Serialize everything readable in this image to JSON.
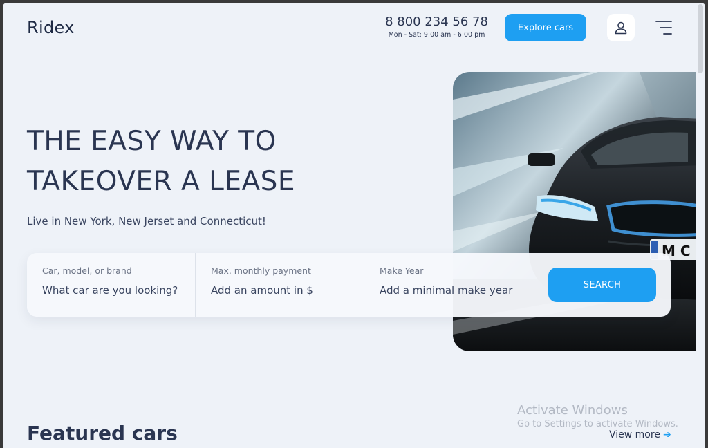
{
  "header": {
    "logo": "Ridex",
    "phone": "8 800 234 56 78",
    "hours": "Mon - Sat: 9:00 am - 6:00 pm",
    "explore_label": "Explore cars"
  },
  "hero": {
    "title_line1": "THE EASY WAY TO",
    "title_line2": "TAKEOVER A LEASE",
    "subtitle": "Live in New York, New Jerset and Connecticut!"
  },
  "search": {
    "fields": [
      {
        "label": "Car, model, or brand",
        "placeholder": "What car are you looking?"
      },
      {
        "label": "Max. monthly payment",
        "placeholder": "Add an amount in $"
      },
      {
        "label": "Make Year",
        "placeholder": "Add a minimal make year"
      }
    ],
    "button_label": "SEARCH"
  },
  "featured": {
    "title": "Featured cars",
    "view_more": "View more"
  },
  "watermark": {
    "line1": "Activate Windows",
    "line2": "Go to Settings to activate Windows."
  },
  "colors": {
    "accent": "#1e9ff2",
    "background": "#eef2f8",
    "text": "#2a3551"
  },
  "icons": [
    "user-icon",
    "menu-icon",
    "arrow-right-icon"
  ]
}
